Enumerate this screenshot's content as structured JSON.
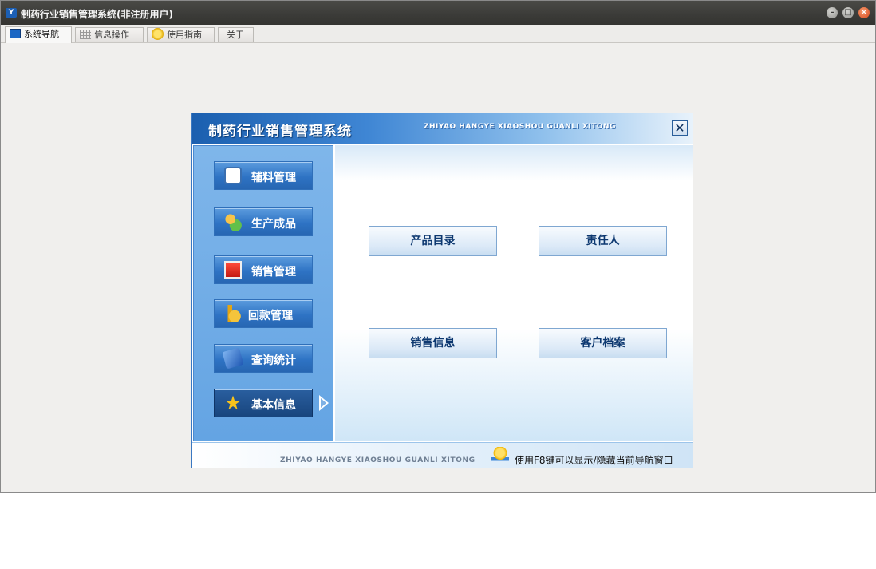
{
  "window": {
    "title": "制药行业销售管理系统(非注册用户)",
    "app_icon_text": "Y",
    "controls": {
      "minimize": "–",
      "maximize": "□",
      "close": "×"
    }
  },
  "tabs": [
    {
      "label": "系统导航",
      "icon": "monitor-icon",
      "active": true
    },
    {
      "label": "信息操作",
      "icon": "grid-icon",
      "active": false
    },
    {
      "label": "使用指南",
      "icon": "help-icon",
      "active": false
    },
    {
      "label": "关于",
      "icon": "",
      "active": false
    }
  ],
  "dialog": {
    "title": "制药行业销售管理系统",
    "subtitle": "ZHIYAO HANGYE XIAOSHOU GUANLI XITONG",
    "close_label": "✕",
    "nav": [
      {
        "label": "辅料管理",
        "icon": "document-icon"
      },
      {
        "label": "生产成品",
        "icon": "people-icon"
      },
      {
        "label": "销售管理",
        "icon": "monitor-red-icon"
      },
      {
        "label": "回款管理",
        "icon": "coins-icon"
      },
      {
        "label": "查询统计",
        "icon": "book-icon"
      },
      {
        "label": "基本信息",
        "icon": "star-icon",
        "selected": true
      }
    ],
    "actions": [
      "产品目录",
      "责任人",
      "销售信息",
      "客户档案"
    ],
    "footer": {
      "brand": "ZHIYAO HANGYE XIAOSHOU GUANLI XITONG",
      "tip": "使用F8键可以显示/隐藏当前导航窗口"
    }
  }
}
